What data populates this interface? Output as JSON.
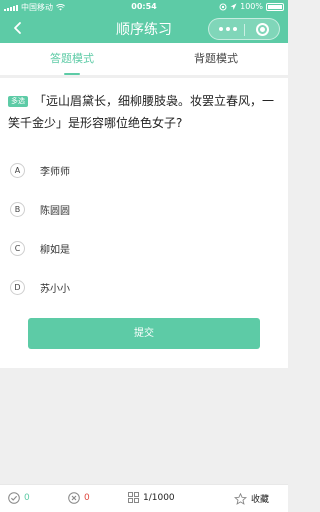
{
  "status_bar": {
    "carrier": "中国移动",
    "time": "00:54",
    "battery": "100%"
  },
  "nav": {
    "title": "顺序练习"
  },
  "tabs": [
    {
      "label": "答题模式",
      "active": true
    },
    {
      "label": "背题模式",
      "active": false
    }
  ],
  "question": {
    "type_badge": "多选",
    "text": "「远山眉黛长，细柳腰肢袅。妆罢立春风，一笑千金少」是形容哪位绝色女子?"
  },
  "options": [
    {
      "key": "A",
      "text": "李师师"
    },
    {
      "key": "B",
      "text": "陈圆圆"
    },
    {
      "key": "C",
      "text": "柳如是"
    },
    {
      "key": "D",
      "text": "苏小小"
    }
  ],
  "submit_label": "提交",
  "bottom_bar": {
    "correct_count": "0",
    "wrong_count": "0",
    "progress": "1/1000",
    "favorite_label": "收藏"
  },
  "colors": {
    "accent": "#5dcba6",
    "error": "#e0473f"
  }
}
